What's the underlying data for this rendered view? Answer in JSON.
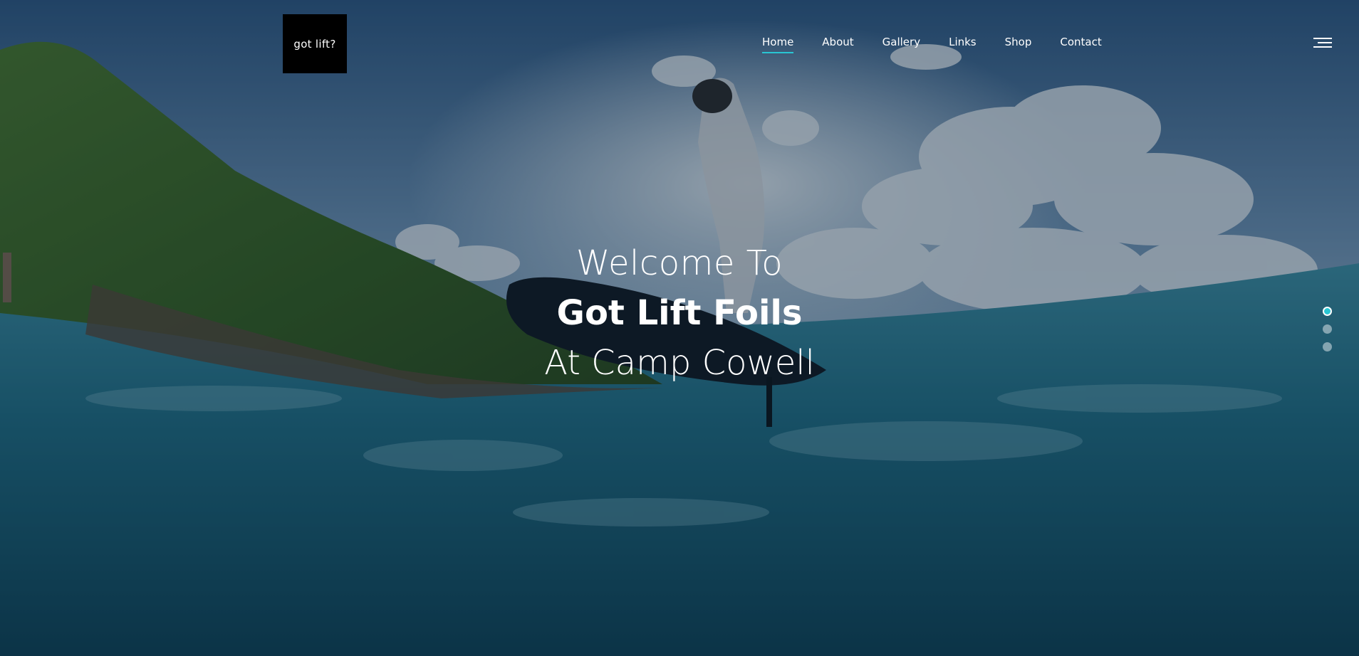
{
  "logo": {
    "text": "got lift?"
  },
  "nav": {
    "items": [
      {
        "label": "Home",
        "active": true
      },
      {
        "label": "About",
        "active": false
      },
      {
        "label": "Gallery",
        "active": false
      },
      {
        "label": "Links",
        "active": false
      },
      {
        "label": "Shop",
        "active": false
      },
      {
        "label": "Contact",
        "active": false
      }
    ],
    "menu_icon": "hamburger-menu-icon"
  },
  "hero": {
    "line1": "Welcome To",
    "line2": "Got Lift Foils",
    "line3": "At Camp Cowell",
    "background_image": "efoil rider over ocean, island on left, clouds"
  },
  "slider": {
    "total": 3,
    "active_index": 0
  },
  "colors": {
    "accent": "#29c6d3",
    "logo_bg": "#000000",
    "text": "#ffffff"
  }
}
